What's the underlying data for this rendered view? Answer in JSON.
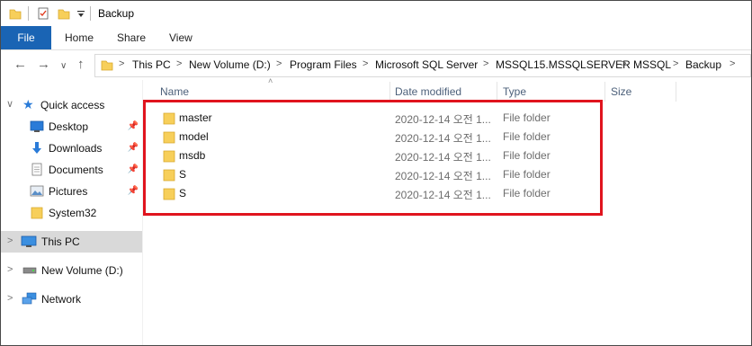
{
  "window": {
    "title": "Backup"
  },
  "ribbon": {
    "tabs": [
      "File",
      "Home",
      "Share",
      "View"
    ]
  },
  "address": {
    "crumbs": [
      "This PC",
      "New Volume (D:)",
      "Program Files",
      "Microsoft SQL Server",
      "MSSQL15.MSSQLSERVER",
      "MSSQL",
      "Backup"
    ]
  },
  "sidebar": {
    "quick_access": "Quick access",
    "pinned": [
      "Desktop",
      "Downloads",
      "Documents",
      "Pictures"
    ],
    "system32": "System32",
    "this_pc": "This PC",
    "new_volume": "New Volume (D:)",
    "network": "Network"
  },
  "columns": {
    "name": "Name",
    "date": "Date modified",
    "type": "Type",
    "size": "Size"
  },
  "files": [
    {
      "name": "master",
      "date": "2020-12-14 오전 1...",
      "type": "File folder"
    },
    {
      "name": "model",
      "date": "2020-12-14 오전 1...",
      "type": "File folder"
    },
    {
      "name": "msdb",
      "date": "2020-12-14 오전 1...",
      "type": "File folder"
    },
    {
      "name": "S",
      "date": "2020-12-14 오전 1...",
      "type": "File folder"
    },
    {
      "name": "S",
      "date": "2020-12-14 오전 1...",
      "type": "File folder"
    }
  ],
  "colors": {
    "accent": "#1a64b4",
    "highlight": "#e0141e",
    "folder": "#f7cf5a"
  }
}
